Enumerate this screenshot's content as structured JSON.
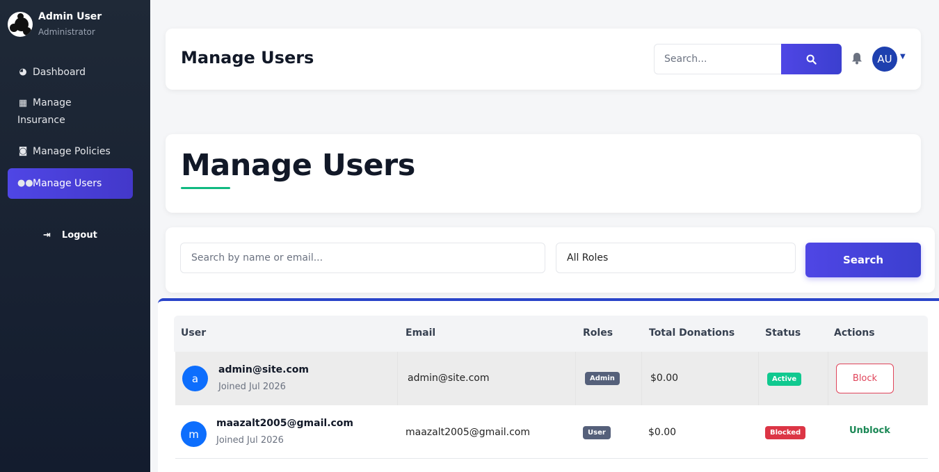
{
  "sidebar": {
    "profile": {
      "name": "Admin User",
      "role": "Administrator"
    },
    "items": [
      {
        "label": "Dashboard",
        "icon": "gauge-icon"
      },
      {
        "label": "Manage\nInsurance",
        "line1": "Manage",
        "line2": "Insurance",
        "icon": "building-icon"
      },
      {
        "label": "Manage Policies",
        "icon": "file-dollar-icon"
      },
      {
        "label": "Manage Users",
        "icon": "users-icon",
        "active": true
      }
    ],
    "logout": "Logout"
  },
  "header": {
    "title": "Manage Users",
    "search_placeholder": "Search...",
    "avatar_initials": "AU"
  },
  "page": {
    "title": "Manage Users",
    "accent_color": "#10b981"
  },
  "filters": {
    "search_placeholder": "Search by name or email...",
    "role_selected": "All Roles",
    "search_button": "Search"
  },
  "table": {
    "columns": [
      "User",
      "Email",
      "Roles",
      "Total Donations",
      "Status",
      "Actions"
    ],
    "rows": [
      {
        "initial": "a",
        "name": "admin@site.com",
        "joined": "Joined Jul 2026",
        "email": "admin@site.com",
        "role": "Admin",
        "donations": "$0.00",
        "status": "Active",
        "action": "Block"
      },
      {
        "initial": "m",
        "name": "maazalt2005@gmail.com",
        "joined": "Joined Jul 2026",
        "email": "maazalt2005@gmail.com",
        "role": "User",
        "donations": "$0.00",
        "status": "Blocked",
        "action": "Unblock"
      }
    ]
  },
  "colors": {
    "primary": "#4f46e5",
    "sidebar": "#1f2937",
    "active_badge": "#10c98f",
    "blocked_badge": "#dc3545"
  }
}
